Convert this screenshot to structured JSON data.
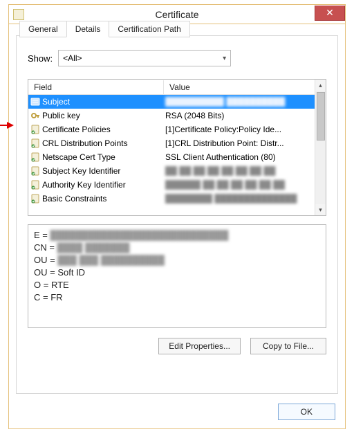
{
  "window": {
    "title": "Certificate",
    "close_icon": "✕"
  },
  "tabs": {
    "general": "General",
    "details": "Details",
    "certpath": "Certification Path"
  },
  "show": {
    "label": "Show:",
    "value": "<All>"
  },
  "listview": {
    "header_field": "Field",
    "header_value": "Value",
    "rows": [
      {
        "field": "Subject",
        "value": "██████████ ██████████",
        "icon": "subject",
        "selected": true,
        "blur_value": true
      },
      {
        "field": "Public key",
        "value": "RSA (2048 Bits)",
        "icon": "key",
        "selected": false,
        "blur_value": false
      },
      {
        "field": "Certificate Policies",
        "value": "[1]Certificate Policy:Policy Ide...",
        "icon": "policy",
        "selected": false,
        "blur_value": false
      },
      {
        "field": "CRL Distribution Points",
        "value": "[1]CRL Distribution Point: Distr...",
        "icon": "crl",
        "selected": false,
        "blur_value": false
      },
      {
        "field": "Netscape Cert Type",
        "value": "SSL Client Authentication (80)",
        "icon": "netscape",
        "selected": false,
        "blur_value": false
      },
      {
        "field": "Subject Key Identifier",
        "value": "██ ██ ██ ██ ██ ██ ██ ██",
        "icon": "ski",
        "selected": false,
        "blur_value": true
      },
      {
        "field": "Authority Key Identifier",
        "value": "██████ ██ ██ ██ ██ ██ ██",
        "icon": "aki",
        "selected": false,
        "blur_value": true
      },
      {
        "field": "Basic Constraints",
        "value": "████████ ██████████████",
        "icon": "basic",
        "selected": false,
        "blur_value": true
      }
    ]
  },
  "detail": {
    "lines": [
      {
        "prefix": "E = ",
        "rest": "████████████████████████████",
        "blur_rest": true
      },
      {
        "prefix": "CN = ",
        "rest": "████ ███████",
        "blur_rest": true
      },
      {
        "prefix": "OU = ",
        "rest": "███ ███ ██████████",
        "blur_rest": true
      },
      {
        "prefix": "OU = ",
        "rest": "Soft ID",
        "blur_rest": false
      },
      {
        "prefix": "O = ",
        "rest": "RTE",
        "blur_rest": false
      },
      {
        "prefix": "C = ",
        "rest": "FR",
        "blur_rest": false
      }
    ]
  },
  "buttons": {
    "edit_properties": "Edit Properties...",
    "copy_to_file": "Copy to File...",
    "ok": "OK"
  }
}
